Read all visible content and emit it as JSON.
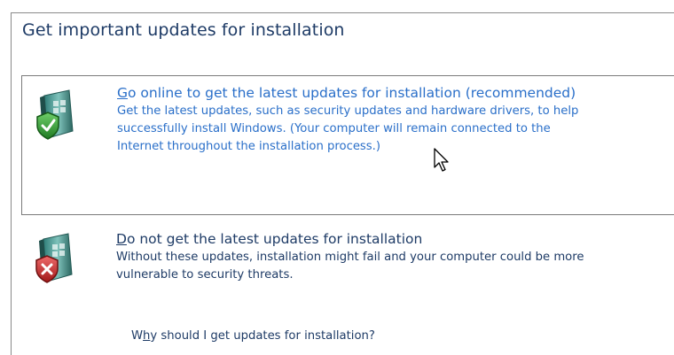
{
  "window": {
    "title": "Get important updates for installation"
  },
  "options": [
    {
      "accel": "G",
      "heading_rest": "o online to get the latest updates for installation (recommended)",
      "description_lines": [
        "Get the latest updates, such as security updates and hardware drivers, to help",
        "successfully install Windows. (Your computer will remain connected to the",
        "Internet throughout the installation process.)"
      ],
      "icon": "shield-check-icon",
      "selected": true
    },
    {
      "accel": "D",
      "heading_rest": "o not get the latest updates for installation",
      "description_lines": [
        "Without these updates, installation might fail and your computer could be more",
        "vulnerable to security threats."
      ],
      "icon": "shield-x-icon",
      "selected": false
    }
  ],
  "help_link": {
    "pre": "W",
    "accel": "h",
    "post": "y should I get updates for installation?"
  },
  "colors": {
    "title": "#1e3b66",
    "selected_option_text": "#2a6fc9",
    "option_text": "#1e3b66",
    "selection_border": "#7a7a7a"
  }
}
